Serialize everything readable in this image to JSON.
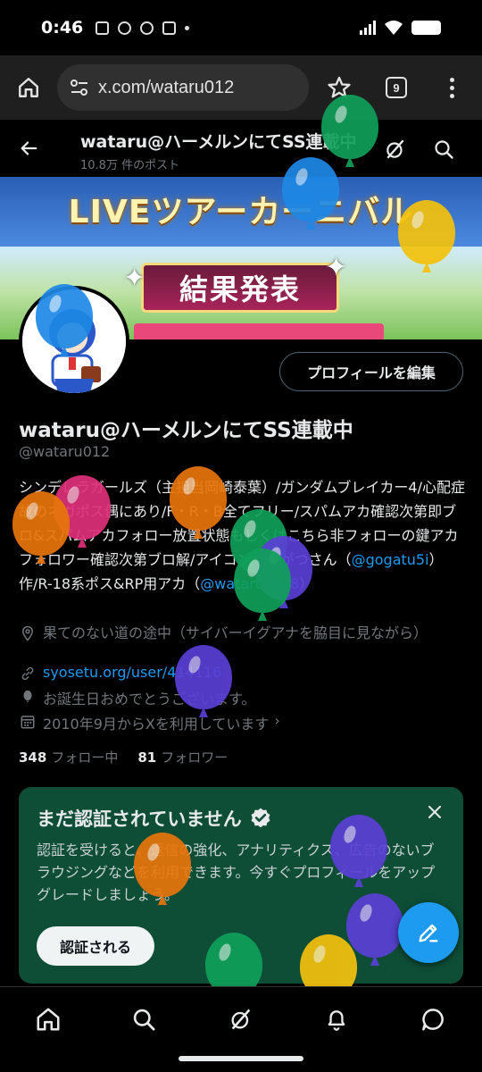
{
  "status_bar": {
    "time": "0:46"
  },
  "browser": {
    "url": "x.com/wataru012",
    "tab_count": "9"
  },
  "header": {
    "title": "wataru@ハーメルンにてSS連載中",
    "post_count": "10.8万 件のポスト"
  },
  "banner": {
    "title": "LIVEツアーカーニバル",
    "subtitle": "結果発表"
  },
  "profile": {
    "edit_button": "プロフィールを編集",
    "display_name": "wataru@ハーメルンにてSS連載中",
    "handle": "@wataru012",
    "bio_text": "シンデレラガールズ（主担当岡崎泰葉）/ガンダムブレイカー4/心配症故のネガポス偶にあり/F・R・B全てフリー/スパムアカ確認次第即ブロ&スパムアカフォロー放置状態もしくはこちら非フォローの鍵アカフォロワー確認次第ブロ解/アイコン〜ごがつさん（",
    "bio_mention_1": "@gogatu5i",
    "bio_text_2": "）作/R-18系ポス&RP用アカ（",
    "bio_mention_2": "@wataru_R18",
    "bio_text_3": "）",
    "location": "果てのない道の途中（サイバーイグアナを脇目に見ながら）",
    "website": "syosetu.org/user/414116",
    "birthday": "お誕生日おめでとうございます。",
    "joined": "2010年9月からXを利用しています",
    "following_count": "348",
    "following_label": "フォロー中",
    "followers_count": "81",
    "followers_label": "フォロワー"
  },
  "verify_card": {
    "title": "まだ認証されていません",
    "body": "認証を受けると、返信の強化、アナリティクス、広告のないブラウジングなどを利用できます。今すぐプロフィールをアップグレードしましょう。",
    "button": "認証される"
  },
  "icons": {
    "home": "home-icon",
    "search": "search-icon",
    "grok": "grok-icon",
    "notifications": "bell-icon",
    "messages": "chat-icon",
    "compose": "compose-icon"
  },
  "colors": {
    "accent": "#1d9bf0",
    "card": "#0e4e37",
    "background": "#000000",
    "balloon_green": "#10a05a",
    "balloon_blue": "#1e88e5",
    "balloon_yellow": "#f4c20d",
    "balloon_orange": "#e8760a",
    "balloon_purple": "#5b3fd6",
    "balloon_pink": "#e0307a"
  }
}
